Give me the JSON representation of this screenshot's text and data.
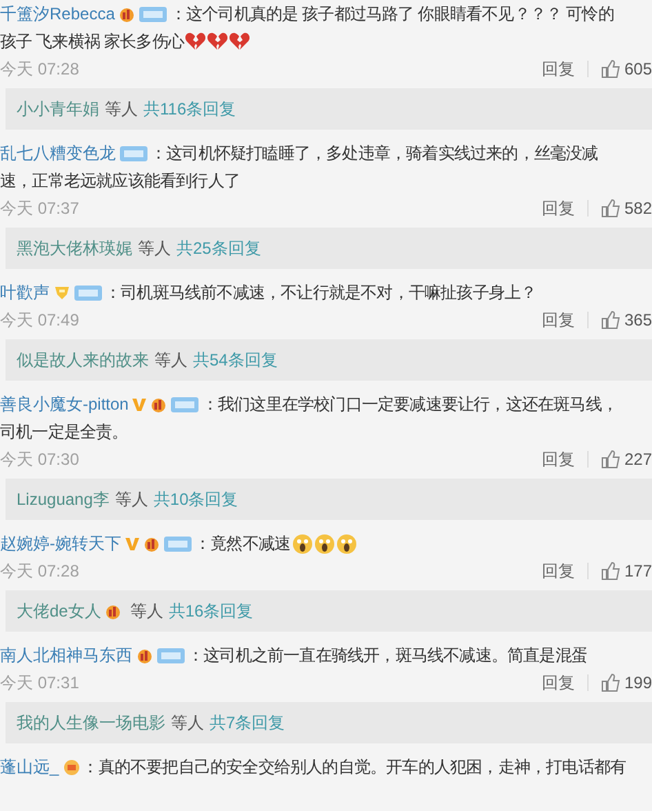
{
  "comments": [
    {
      "user": "千簠汐Rebecca",
      "badges": [
        {
          "kind": "vip"
        },
        {
          "kind": "fan"
        }
      ],
      "lines": [
        "：这个司机真的是 孩子都过马路了 你眼睛看不见？？？ 可怜的",
        "孩子 飞来横祸 家长多伤心"
      ],
      "emojis": [
        {
          "kind": "broken-heart"
        },
        {
          "kind": "broken-heart"
        },
        {
          "kind": "broken-heart"
        }
      ],
      "time": "今天 07:28",
      "reply": "回复",
      "likes": "605",
      "summary": {
        "name": "小小青年娟",
        "middle": "等人",
        "count": "共116条回复"
      }
    },
    {
      "user": "乱七八糟变色龙",
      "badges": [
        {
          "kind": "fan"
        }
      ],
      "lines": [
        "：这司机怀疑打瞌睡了，多处违章，骑着实线过来的，丝毫没减",
        "速，正常老远就应该能看到行人了"
      ],
      "time": "今天 07:37",
      "reply": "回复",
      "likes": "582",
      "summary": {
        "name": "黑泡大佬林瑛娓",
        "middle": "等人",
        "count": "共25条回复"
      }
    },
    {
      "user": "叶歡声",
      "badges": [
        {
          "kind": "gold"
        },
        {
          "kind": "fan"
        }
      ],
      "lines": [
        "：司机斑马线前不减速，不让行就是不对，干嘛扯孩子身上？"
      ],
      "time": "今天 07:49",
      "reply": "回复",
      "likes": "365",
      "summary": {
        "name": "似是故人来的故来",
        "middle": "等人",
        "count": "共54条回复"
      }
    },
    {
      "user": "善良小魔女-pitton",
      "badges": [
        {
          "kind": "verified"
        },
        {
          "kind": "vip"
        },
        {
          "kind": "fan"
        }
      ],
      "lines": [
        "：我们这里在学校门口一定要减速要让行，这还在斑马线，",
        "司机一定是全责。"
      ],
      "time": "今天 07:30",
      "reply": "回复",
      "likes": "227",
      "summary": {
        "name": "Lizuguang李",
        "middle": "等人",
        "count": "共10条回复"
      }
    },
    {
      "user": "赵婉婷-婉转天下",
      "badges": [
        {
          "kind": "verified"
        },
        {
          "kind": "vip"
        },
        {
          "kind": "fan"
        }
      ],
      "lines": [
        "：竟然不减速"
      ],
      "emojis": [
        {
          "kind": "scream"
        },
        {
          "kind": "scream"
        },
        {
          "kind": "scream"
        }
      ],
      "time": "今天 07:28",
      "reply": "回复",
      "likes": "177",
      "summary": {
        "name": "大佬de女人",
        "badges": [
          {
            "kind": "vip"
          }
        ],
        "middle": "等人",
        "count": "共16条回复"
      }
    },
    {
      "user": "南人北相神马东西",
      "badges": [
        {
          "kind": "vip"
        },
        {
          "kind": "fan"
        }
      ],
      "lines": [
        "：这司机之前一直在骑线开，斑马线不减速。简直是混蛋"
      ],
      "time": "今天 07:31",
      "reply": "回复",
      "likes": "199",
      "summary": {
        "name": "我的人生像一场电影",
        "middle": "等人",
        "count": "共7条回复"
      }
    },
    {
      "user": "蓬山远_",
      "badges": [
        {
          "kind": "member"
        }
      ],
      "lines": [
        "：真的不要把自己的安全交给别人的自觉。开车的人犯困，走神，打电话都有"
      ]
    }
  ]
}
